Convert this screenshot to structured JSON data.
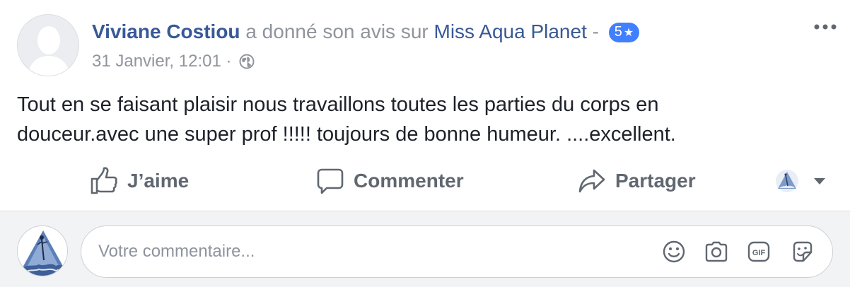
{
  "post": {
    "author": "Viviane Costiou",
    "action_text": " a donné son avis sur ",
    "page_name": "Miss Aqua Planet",
    "separator": " - ",
    "rating_value": "5",
    "rating_star": "★",
    "timestamp": "31 Janvier, 12:01",
    "meta_separator": " · ",
    "privacy_icon": "globe-icon",
    "text_line1": "Tout en se faisant plaisir nous travaillons toutes les parties du corps en",
    "text_line2": "douceur.avec une super prof !!!!! toujours de bonne humeur. ....excellent."
  },
  "actions": {
    "like_label": "J’aime",
    "comment_label": "Commenter",
    "share_label": "Partager"
  },
  "comment": {
    "placeholder": "Votre commentaire...",
    "icons": [
      "emoji-icon",
      "camera-icon",
      "gif-icon",
      "sticker-icon"
    ]
  },
  "colors": {
    "link": "#385898",
    "secondary_text": "#90949c",
    "action_text": "#606770",
    "rating_badge": "#4080ff",
    "comment_bg": "#f2f3f5"
  }
}
